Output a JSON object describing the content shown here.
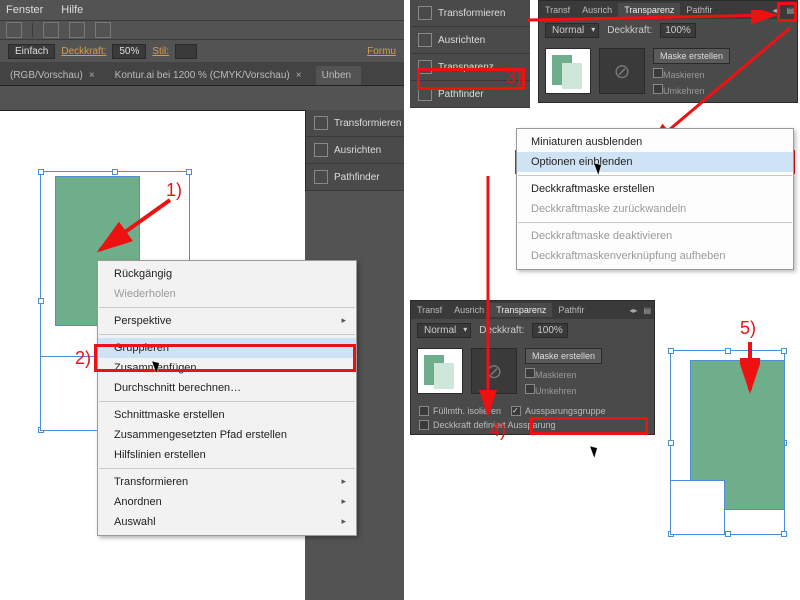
{
  "menubar": {
    "fenster": "Fenster",
    "hilfe": "Hilfe"
  },
  "optbar": {
    "einfach": "Einfach",
    "deckkraft_label": "Deckkraft:",
    "deckkraft_value": "50%",
    "stil_label": "Stil:",
    "formu": "Formu"
  },
  "tabs": {
    "t1": "(RGB/Vorschau)",
    "t2": "Kontur.ai bei 1200 % (CMYK/Vorschau)",
    "t3": "Unben",
    "close": "×"
  },
  "dock": {
    "transformieren": "Transformieren",
    "ausrichten": "Ausrichten",
    "transparenz": "Transparenz",
    "pathfinder": "Pathfinder"
  },
  "context_menu": {
    "ruckgangig": "Rückgängig",
    "wiederholen": "Wiederholen",
    "perspektive": "Perspektive",
    "gruppieren": "Gruppieren",
    "zusammenfugen": "Zusammenfügen",
    "durchschnitt": "Durchschnitt berechnen…",
    "schnittmaske": "Schnittmaske erstellen",
    "zusammengesetzten": "Zusammengesetzten Pfad erstellen",
    "hilfslinien": "Hilfslinien erstellen",
    "transformieren": "Transformieren",
    "anordnen": "Anordnen",
    "auswahl": "Auswahl"
  },
  "top_panel": {
    "tabs": {
      "transf": "Transf",
      "ausricht": "Ausrich",
      "transparenz": "Transparenz",
      "pathfir": "Pathfir"
    },
    "blend": "Normal",
    "deckkraft_label": "Deckkraft:",
    "deckkraft_value": "100%",
    "maske_erstellen": "Maske erstellen",
    "maskieren": "Maskieren",
    "umkehren": "Umkehren",
    "fullmth": "Füllmth. isolieren",
    "aussparung": "Aussparungsgruppe",
    "deckkraft_definiert": "Deckkraft definiert Aussparung"
  },
  "flyout": {
    "miniaturen": "Miniaturen ausblenden",
    "optionen": "Optionen einblenden",
    "dm_erstellen": "Deckkraftmaske erstellen",
    "dm_ruckwandeln": "Deckkraftmaske zurückwandeln",
    "dm_deaktivieren": "Deckkraftmaske deaktivieren",
    "dm_verknupfung": "Deckkraftmaskenverknüpfung aufheben"
  },
  "labels": {
    "l1": "1)",
    "l2": "2)",
    "l3": "3)",
    "l4": "4)",
    "l5": "5)"
  }
}
